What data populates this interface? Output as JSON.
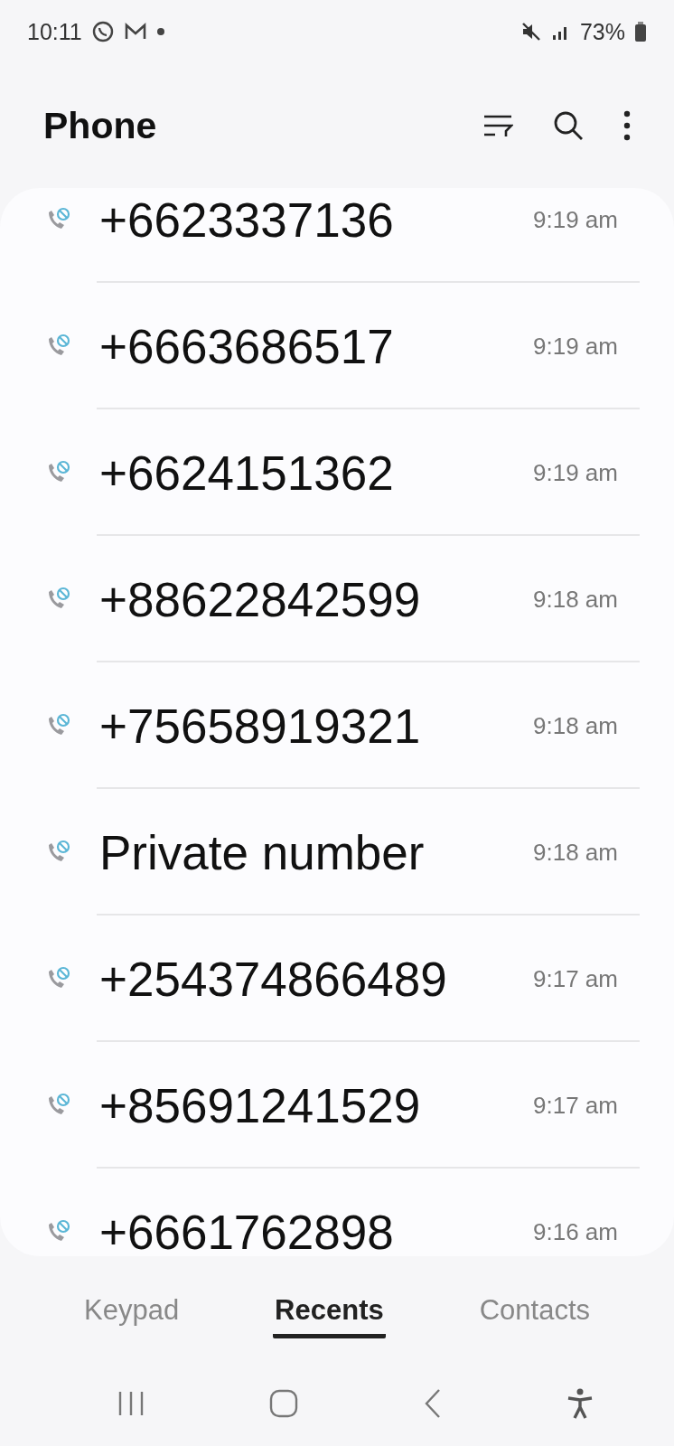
{
  "status_bar": {
    "time": "10:11",
    "battery": "73%"
  },
  "header": {
    "title": "Phone"
  },
  "calls": [
    {
      "number": "+6623337136",
      "time": "9:19 am"
    },
    {
      "number": "+6663686517",
      "time": "9:19 am"
    },
    {
      "number": "+6624151362",
      "time": "9:19 am"
    },
    {
      "number": "+88622842599",
      "time": "9:18 am"
    },
    {
      "number": "+75658919321",
      "time": "9:18 am"
    },
    {
      "number": "Private number",
      "time": "9:18 am"
    },
    {
      "number": "+254374866489",
      "time": "9:17 am"
    },
    {
      "number": "+85691241529",
      "time": "9:17 am"
    },
    {
      "number": "+6661762898",
      "time": "9:16 am"
    }
  ],
  "tabs": [
    {
      "label": "Keypad",
      "selected": false
    },
    {
      "label": "Recents",
      "selected": true
    },
    {
      "label": "Contacts",
      "selected": false
    }
  ]
}
